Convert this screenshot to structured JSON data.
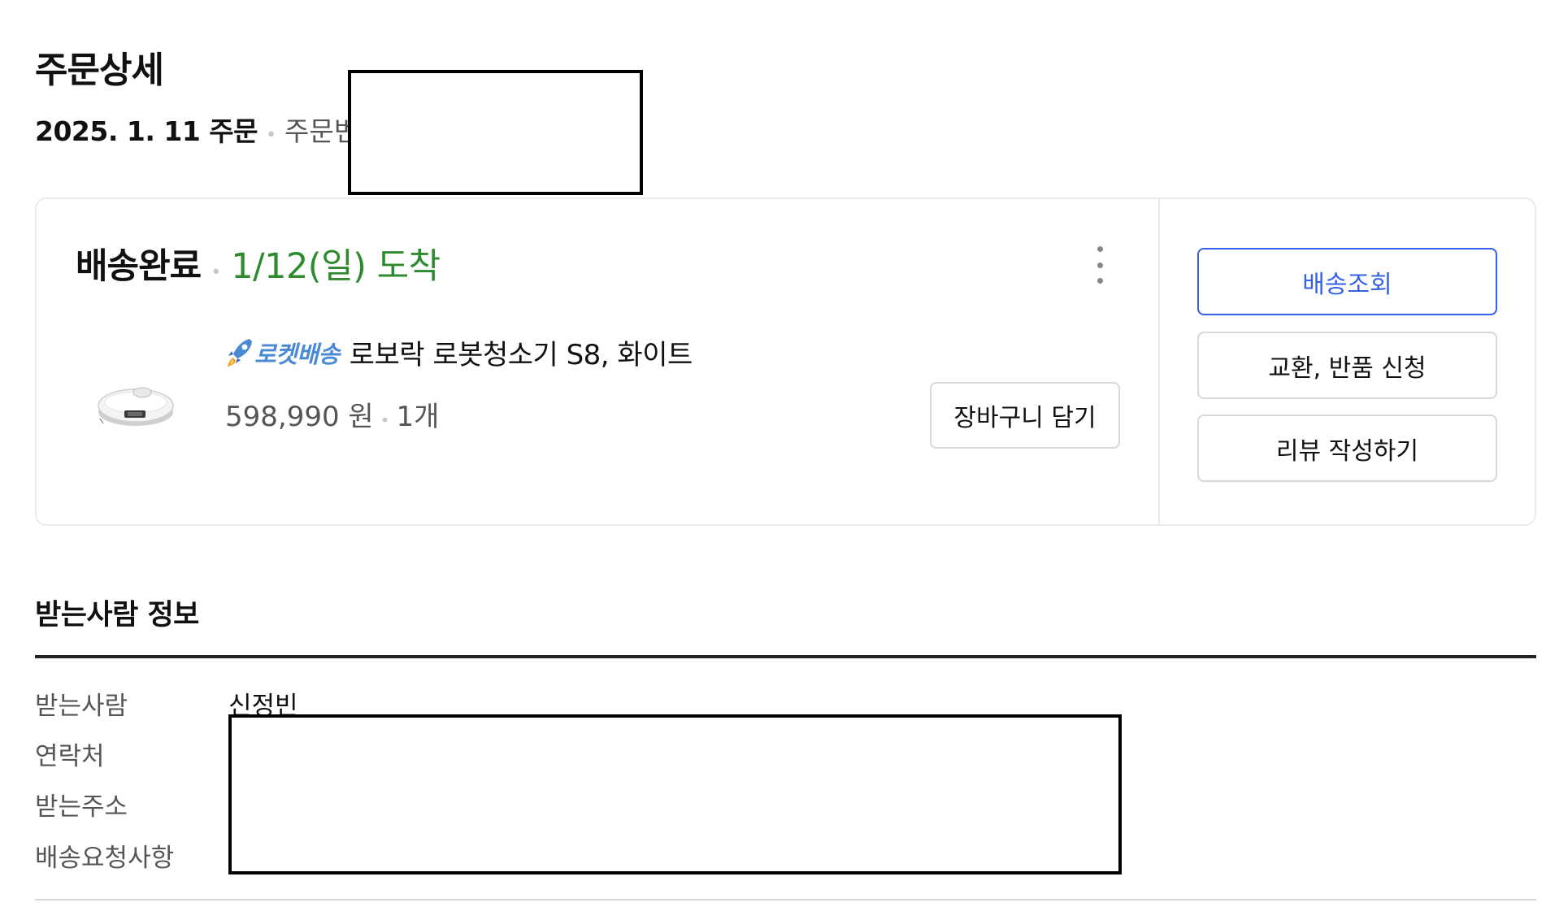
{
  "page": {
    "title": "주문상세",
    "order_date": "2025. 1. 11 주문",
    "order_number_label": "주문번호"
  },
  "delivery": {
    "status": "배송완료",
    "arrival": "1/12(일) 도착",
    "more_icon": "more-vertical-icon",
    "product": {
      "badge_icon": "rocket-icon",
      "badge_label": "로켓배송",
      "name": "로보락 로봇청소기 S8, 화이트",
      "price": "598,990 원",
      "quantity": "1개"
    },
    "cart_button": "장바구니 담기",
    "actions": {
      "track": "배송조회",
      "return": "교환, 반품 신청",
      "review": "리뷰 작성하기"
    },
    "colors": {
      "arrival_green": "#2e8b2e",
      "track_blue": "#3461e8",
      "rocket_blue": "#4a8ad4"
    }
  },
  "recipient": {
    "section_title": "받는사람 정보",
    "rows": [
      {
        "label": "받는사람",
        "value": "신정빈"
      },
      {
        "label": "연락처",
        "value": ""
      },
      {
        "label": "받는주소",
        "value": ""
      },
      {
        "label": "배송요청사항",
        "value": ""
      }
    ]
  }
}
